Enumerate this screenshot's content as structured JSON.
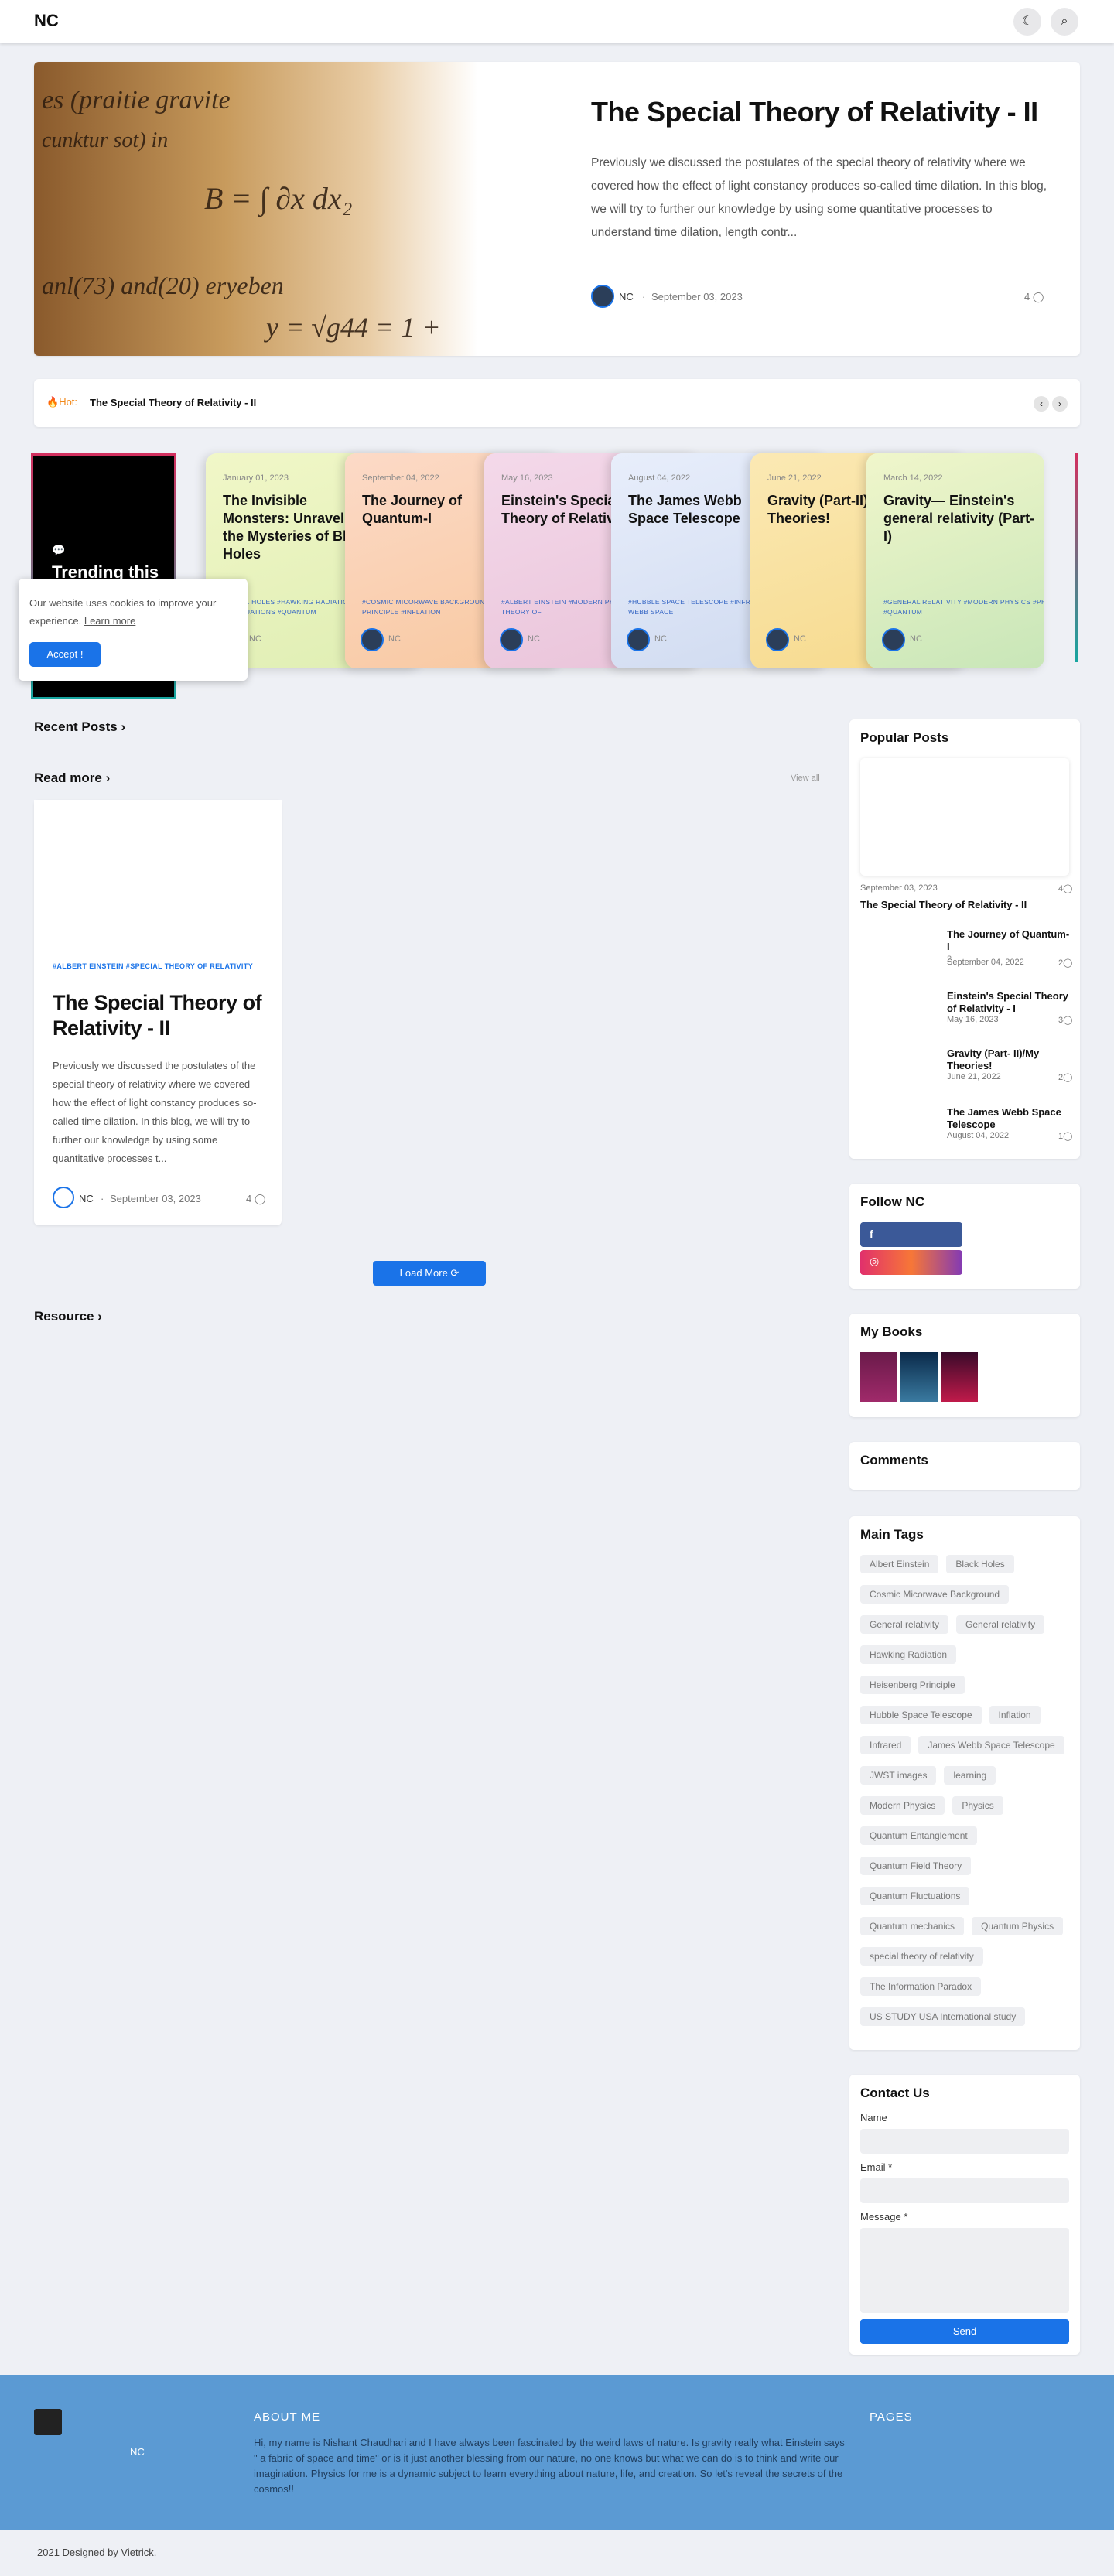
{
  "header": {
    "logo": "NC",
    "theme_icon": "☾",
    "search_icon": "⌕"
  },
  "hero": {
    "title": "The Special Theory of Relativity - II",
    "excerpt": "Previously we discussed the postulates of the special theory of relativity where we covered how the effect of light constancy produces so-called time dilation. In this blog, we will try to further our knowledge by using some quantitative processes to understand time dilation, length contr...",
    "author": "NC",
    "sep": "·",
    "date": "September 03, 2023",
    "comments": "4"
  },
  "ticker": {
    "hot_label": "Hot:",
    "headline": "The Special Theory of Relativity - II",
    "prev": "‹",
    "next": "›"
  },
  "trending": {
    "title": "Trending this"
  },
  "trend_cards": [
    {
      "date": "January 01, 2023",
      "comments": "",
      "title": "The Invisible Monsters: Unraveling the Mysteries of Black Holes",
      "tags": "#BLACK HOLES   #HAWKING RADIATION   #QUANTUM FLUCTUATIONS   #QUANTUM",
      "author": "NC"
    },
    {
      "date": "September 04, 2022",
      "comments": "2",
      "title": "The Journey of Quantum-I",
      "tags": "#COSMIC MICORWAVE BACKGROUND   #HEISENBERG PRINCIPLE   #INFLATION",
      "author": "NC"
    },
    {
      "date": "May 16, 2023",
      "comments": "3",
      "title": "Einstein's Special Theory of Relativity - I",
      "tags": "#ALBERT EINSTEIN   #MODERN PHYSICS   #SPECIAL THEORY OF",
      "author": "NC"
    },
    {
      "date": "August 04, 2022",
      "comments": "1",
      "title": "The James Webb Space Telescope",
      "tags": "#HUBBLE SPACE TELESCOPE   #INFRARED   #JAMES WEBB SPACE",
      "author": "NC"
    },
    {
      "date": "June 21, 2022",
      "comments": "2",
      "title": "Gravity (Part-II)/My Theories!",
      "tags": "",
      "author": "NC"
    },
    {
      "date": "March 14, 2022",
      "comments": "",
      "title": "Gravity— Einstein's general relativity (Part-I)",
      "tags": "#GENERAL RELATIVITY   #MODERN PHYSICS   #PHYSICS   #QUANTUM",
      "author": "NC"
    }
  ],
  "cookie": {
    "text": "Our website uses cookies to improve your experience.",
    "link": "Learn more",
    "button": "Accept !"
  },
  "sections": {
    "recent": "Recent Posts",
    "read_more": "Read more",
    "view_all": "View all",
    "resource": "Resource",
    "chev": "›"
  },
  "post": {
    "tags": "#ALBERT EINSTEIN     #SPECIAL THEORY OF RELATIVITY",
    "title": "The Special Theory of Relativity - II",
    "excerpt": "Previously we discussed the postulates of the special theory of relativity where we covered how the effect of light constancy produces so-called time dilation. In this blog, we will try to further our knowledge by using some quantitative processes t...",
    "author": "NC",
    "date": "September 03, 2023",
    "comments": "4"
  },
  "load_more": "Load More ⟳",
  "popular": {
    "heading": "Popular Posts",
    "top": {
      "date": "September 03, 2023",
      "comments": "4",
      "title": "The Special Theory of Relativity - II"
    },
    "items": [
      {
        "title": "The Journey of Quantum-I",
        "date": "September 04, 2022",
        "comments": "2"
      },
      {
        "title": "Einstein's Special Theory of Relativity - I",
        "date": "May 16, 2023",
        "comments": "3"
      },
      {
        "title": "Gravity (Part- II)/My Theories!",
        "date": "June 21, 2022",
        "comments": "2"
      },
      {
        "title": "The James Webb Space Telescope",
        "date": "August 04, 2022",
        "comments": "1"
      }
    ]
  },
  "follow": {
    "heading": "Follow NC",
    "fb": "f",
    "ig": "◎"
  },
  "books": {
    "heading": "My Books"
  },
  "comments_w": {
    "heading": "Comments"
  },
  "tags": {
    "heading": "Main Tags",
    "list": [
      "Albert Einstein",
      "Black Holes",
      "Cosmic Micorwave Background",
      "General relativity",
      "General relativity",
      "Hawking Radiation",
      "Heisenberg Principle",
      "Hubble Space Telescope",
      "Inflation",
      "Infrared",
      "James Webb Space Telescope",
      "JWST images",
      "learning",
      "Modern Physics",
      "Physics",
      "Quantum Entanglement",
      "Quantum Field Theory",
      "Quantum Fluctuations",
      "Quantum mechanics",
      "Quantum Physics",
      "special theory of relativity",
      "The Information Paradox",
      "US STUDY USA International study"
    ]
  },
  "contact": {
    "heading": "Contact Us",
    "name": "Name",
    "email": "Email *",
    "message": "Message *",
    "send": "Send"
  },
  "footer": {
    "name": "NC",
    "about_h": "ABOUT ME",
    "about": "Hi, my name is Nishant Chaudhari and I have always been fascinated by the weird laws of nature. Is gravity really what Einstein says \" a fabric of space and time\" or is it just another blessing from our nature, no one knows but what we can do is to think and write our imagination. Physics for me is a dynamic subject to learn everything about nature, life, and creation. So let's reveal the secrets of the cosmos!!",
    "pages_h": "PAGES",
    "credit": "2021 Designed by Vietrick."
  }
}
